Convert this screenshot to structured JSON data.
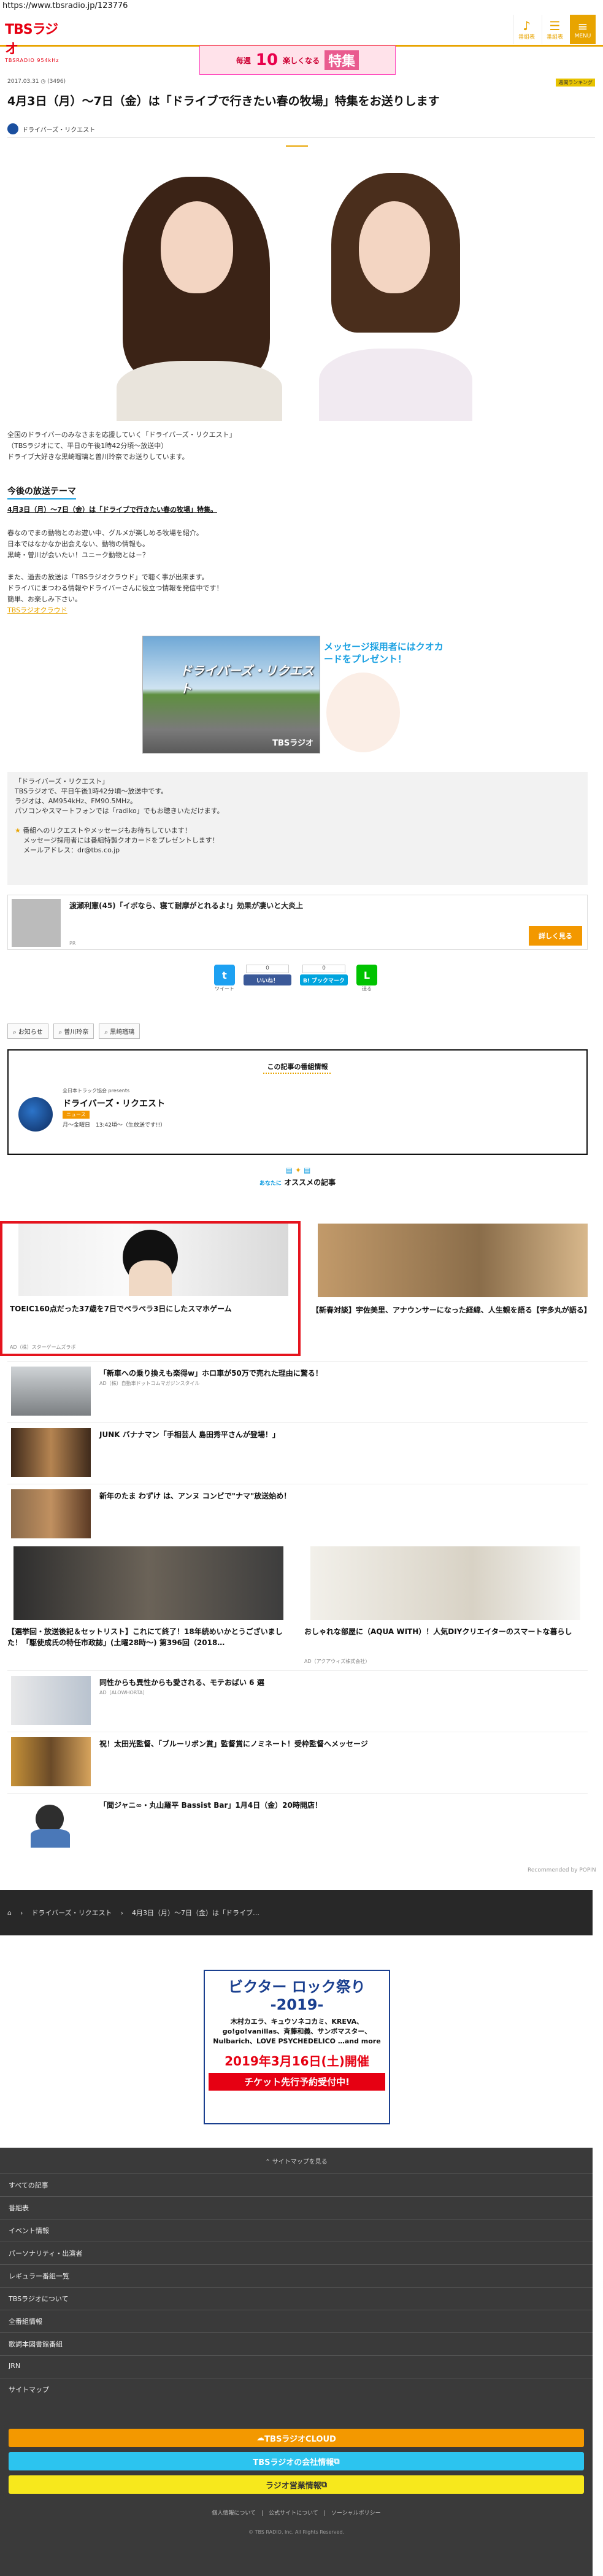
{
  "url": "https://www.tbsradio.jp/123776",
  "header": {
    "logo_main": "TBSラジオ",
    "logo_sub": "TBSRADIO 954kHz",
    "icons": [
      {
        "label": "番組表",
        "icon": "radio-icon"
      },
      {
        "label": "番組表",
        "icon": "list-icon"
      },
      {
        "label": "MENU",
        "icon": "menu-icon"
      }
    ]
  },
  "banner": {
    "pre": "毎週",
    "num": "10",
    "mid": "楽しくなる",
    "tail": "特集"
  },
  "meta": {
    "date": "2017.03.31",
    "views": "(3496)",
    "badge": "週間ランキング"
  },
  "article": {
    "title": "4月3日（月）～7日（金）は「ドライブで行きたい春の牧場」特集をお送りします",
    "author": "ドライバーズ・リクエスト",
    "intro": [
      "全国のドライバーのみなさまを応援していく「ドライバーズ・リクエスト」",
      "（TBSラジオにて、平日の午後1時42分頃～放送中）",
      "ドライブ大好きな黒崎瑠璃と曽川玲奈でお送りしています。"
    ],
    "section_heading": "今後の放送テーマ",
    "section_sub": "4月3日（月）～7日（金）は「ドライブで行きたい春の牧場」特集。",
    "body": [
      "春なのでまの動物とのお遊い中、グルメが楽しめる牧場を紹介。",
      "日本ではなかなか出会えない、動物の情報も。",
      "黒崎・曽川が会いたい！ユニーク動物とは－？",
      "",
      "また、過去の放送は「TBSラジオクラウド」で聴く事が出来ます。",
      "ドライバにまつわる情報やドライバーさんに役立つ情報を発信中です！",
      "簡単、お楽しみ下さい。"
    ],
    "body_link": "TBSラジオクラウド"
  },
  "promo": {
    "title": "ドライバーズ・リクエスト",
    "caption": "メッセージ採用者にはクオカードをプレゼント！",
    "logo": "TBSラジオ"
  },
  "infobox": {
    "lines": [
      "「ドライバーズ・リクエスト」",
      "TBSラジオで、平日午後1時42分頃～放送中です。",
      "ラジオは、AM954kHz、FM90.5MHz。",
      "パソコンやスマートフォンでは「radiko」でもお聴きいただけます。",
      "",
      "番組へのリクエストやメッセージもお待ちしています！",
      "メッセージ採用者には番組特製クオカードをプレゼントします！",
      "メールアドレス：dr@tbs.co.jp"
    ]
  },
  "related": {
    "title": "渡瀬利憲(45)「イボなら、寝て耐摩がとれるよ!」効果が凄いと大炎上",
    "source": "PR",
    "more": "詳しく見る"
  },
  "share": {
    "tweet": "ツイート",
    "like_count": "0",
    "like": "いいね！",
    "hatena_count": "0",
    "hatena": "B! ブックマーク",
    "line": "送る"
  },
  "tags": [
    "お知らせ",
    "曽川玲奈",
    "黒崎瑠璃"
  ],
  "program": {
    "heading": "この記事の番組情報",
    "sponsor": "全日本トラック協会 presents",
    "name": "ドライバーズ・リクエスト",
    "badge": "ニュース",
    "time": "月～金曜日　13:42頃～（生放送です!!）"
  },
  "recommend": {
    "heading": "オススメの記事",
    "prefix": "あなたに"
  },
  "cards": [
    {
      "title": "TOEIC160点だった37歳を7日でペラペラ3日にしたスマホゲーム",
      "source": "AD（株）スターゲームズラボ"
    },
    {
      "title": "【新春対談】宇佐美里、アナウンサーになった経緯、人生観を語る【宇多丸が語る】",
      "source": ""
    },
    {
      "title": "「新車への乗り換えも楽得w」ホロ車が50万で売れた理由に驚る！",
      "source": "AD（株）自動車ドットコムマガジンスタイル"
    },
    {
      "title": "JUNK バナナマン「手相芸人 島田秀平さんが登場！」",
      "source": ""
    },
    {
      "title": "新年のたま わずけ は、アンヌ コンビで\"ナマ\"放送始め！",
      "source": ""
    },
    {
      "title": "【選挙回・放送後記＆セットリスト】これにて終了！18年続めいかとうございました！「駆使成氏の特任市政誌」(土曜28時～) 第396回（2018…",
      "source": ""
    },
    {
      "title": "おしゃれな部屋に（AQUA WITH）！人気DIYクリエイターのスマートな暮らし",
      "source": "AD（アクアウィズ株式会社）"
    },
    {
      "title": "同性からも異性からも愛される、モテおばい 6 選",
      "source": "AD（ALOWHORTA）"
    },
    {
      "title": "祝！太田光監督、「ブルーリボン賞」監督賞にノミネート！受枠監督へメッセージ",
      "source": ""
    },
    {
      "title": "「聞ジャニ∞・丸山羅平 Bassist Bar」1月4日（金）20時開店！",
      "source": ""
    }
  ],
  "powered": "Recommended by POPIN",
  "breadcrumb": [
    "ドライバーズ・リクエスト",
    "4月3日（月）～7日（金）は「ドライブ…"
  ],
  "ad": {
    "title": "ビクター ロック祭り -2019-",
    "artists": "木村カエラ、キュウソネコカミ、KREVA、go!go!vanillas、斉藤和義、サンボマスター、Nulbarich、LOVE PSYCHEDELICO …and more",
    "date": "2019年3月16日(土)開催",
    "ticket": "チケット先行予約受付中!"
  },
  "footer": {
    "heading": "サイトマップを見る",
    "items": [
      "すべての記事",
      "番組表",
      "イベント情報",
      "パーソナリティ・出演者",
      "レギュラー番組一覧",
      "TBSラジオについて",
      "全番組情報",
      "歌詞本図書館番組",
      "JRN",
      "サイトマップ"
    ],
    "cloud": "TBSラジオCLOUD",
    "corp": "TBSラジオの会社情報",
    "sales": "ラジオ営業情報",
    "links": "個人情報について　|　公式サイトについて　|　ソーシャルポリシー",
    "copyright": "© TBS RADIO, Inc. All Rights Reserved."
  },
  "colors": {
    "brand": "#e8a400",
    "red": "#e60012",
    "accent_blue": "#1aa1e2"
  }
}
